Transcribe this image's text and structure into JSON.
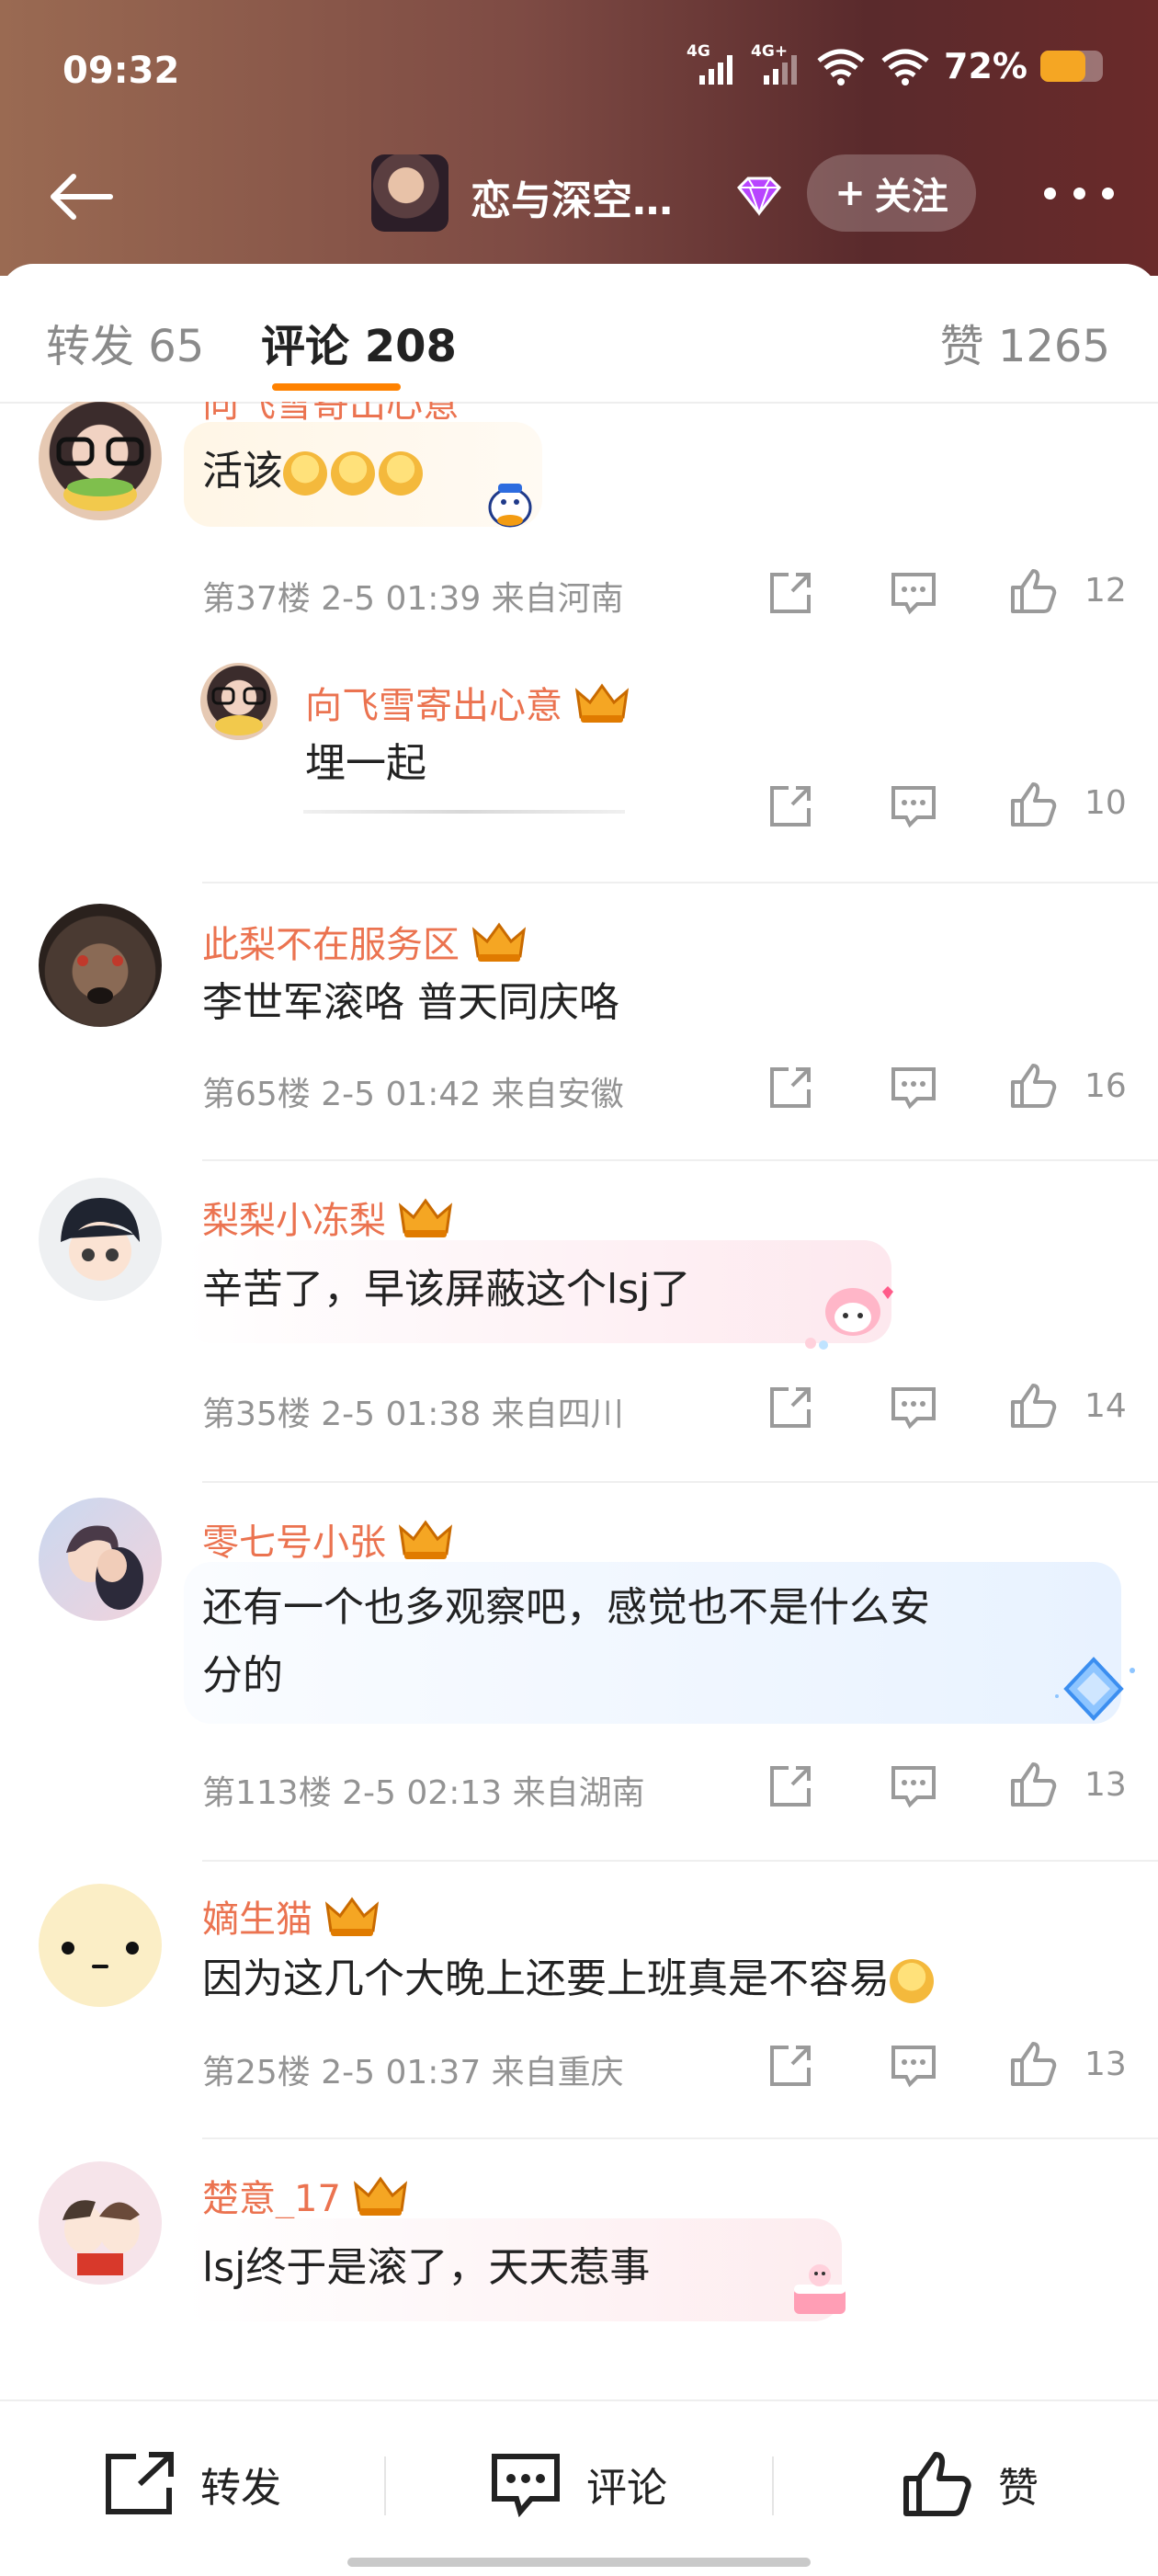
{
  "status": {
    "time": "09:32",
    "net1": "4G",
    "net2": "4G+",
    "battery_pct": "72%",
    "battery_level": 0.72
  },
  "header": {
    "account_name": "恋与深空…",
    "follow_label": "关注",
    "follow_plus": "+"
  },
  "tabs": [
    {
      "label": "转发 65"
    },
    {
      "label": "评论 208"
    },
    {
      "label": "赞 1265"
    }
  ],
  "comments": [
    {
      "user": "向飞雪寄出心意",
      "text": "活该",
      "meta": "第37楼 2-5 01:39 来自河南",
      "likes": "12"
    },
    {
      "user": "向飞雪寄出心意",
      "text": "埋一起",
      "likes": "10"
    },
    {
      "user": "此梨不在服务区",
      "text": "李世军滚咯 普天同庆咯",
      "meta": "第65楼 2-5 01:42 来自安徽",
      "likes": "16"
    },
    {
      "user": "梨梨小冻梨",
      "text": "辛苦了，早该屏蔽这个lsj了",
      "meta": "第35楼 2-5 01:38 来自四川",
      "likes": "14"
    },
    {
      "user": "零七号小张",
      "text_line1": "还有一个也多观察吧，感觉也不是什么安",
      "text_line2": "分的",
      "meta": "第113楼 2-5 02:13 来自湖南",
      "likes": "13"
    },
    {
      "user": "嫡生猫",
      "text": "因为这几个大晚上还要上班真是不容易",
      "meta": "第25楼 2-5 01:37 来自重庆",
      "likes": "13"
    },
    {
      "user": "楚意_17",
      "text": "lsj终于是滚了，天天惹事"
    }
  ],
  "bottom_bar": {
    "repost": "转发",
    "comment": "评论",
    "like": "赞"
  },
  "colors": {
    "accent": "#ff8200",
    "username": "#eb7350",
    "meta": "#939393"
  },
  "icons": [
    "back-arrow-icon",
    "gem-icon",
    "more-icon",
    "crown-badge-icon",
    "share-icon",
    "comment-icon",
    "like-icon"
  ]
}
